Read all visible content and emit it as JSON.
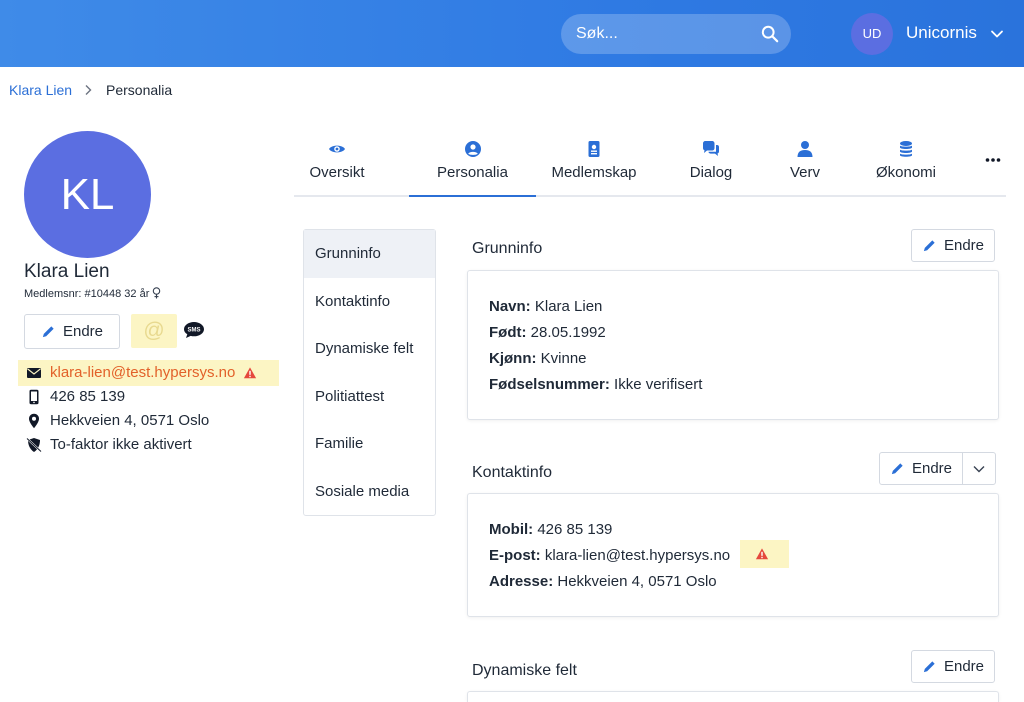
{
  "header": {
    "search_placeholder": "Søk...",
    "user_initials": "UD",
    "org_name": "Unicornis"
  },
  "breadcrumb": {
    "parent": "Klara Lien",
    "current": "Personalia"
  },
  "profile": {
    "initials": "KL",
    "name": "Klara Lien",
    "member_no": "Medlemsnr: #10448",
    "age": "32 år",
    "edit_label": "Endre",
    "at_symbol": "@",
    "email": "klara-lien@test.hypersys.no",
    "phone": "426 85 139",
    "address": "Hekkveien 4, 0571 Oslo",
    "two_factor": "To-faktor ikke aktivert"
  },
  "tabs": [
    {
      "label": "Oversikt",
      "icon": "eye-icon"
    },
    {
      "label": "Personalia",
      "icon": "user-circle-icon"
    },
    {
      "label": "Medlemskap",
      "icon": "id-card-icon"
    },
    {
      "label": "Dialog",
      "icon": "comments-icon"
    },
    {
      "label": "Verv",
      "icon": "user-icon"
    },
    {
      "label": "Økonomi",
      "icon": "coins-icon"
    }
  ],
  "subnav": [
    "Grunninfo",
    "Kontaktinfo",
    "Dynamiske felt",
    "Politiattest",
    "Familie",
    "Sosiale media"
  ],
  "sections": {
    "grunninfo": {
      "title": "Grunninfo",
      "edit_label": "Endre",
      "fields": [
        {
          "label": "Navn:",
          "value": "Klara Lien"
        },
        {
          "label": "Født:",
          "value": "28.05.1992"
        },
        {
          "label": "Kjønn:",
          "value": "Kvinne"
        },
        {
          "label": "Fødselsnummer:",
          "value": "Ikke verifisert"
        }
      ]
    },
    "kontaktinfo": {
      "title": "Kontaktinfo",
      "edit_label": "Endre",
      "fields": [
        {
          "label": "Mobil:",
          "value": "426 85 139"
        },
        {
          "label": "E-post:",
          "value": "klara-lien@test.hypersys.no"
        },
        {
          "label": "Adresse:",
          "value": "Hekkveien 4, 0571 Oslo"
        }
      ]
    },
    "dynamiske": {
      "title": "Dynamiske felt",
      "edit_label": "Endre"
    }
  },
  "colors": {
    "header_blue": "#2f7ae3",
    "accent": "#2b6fd6",
    "avatar": "#5b6ee1",
    "warning": "#e2612a",
    "highlight": "#fcf5c4"
  }
}
